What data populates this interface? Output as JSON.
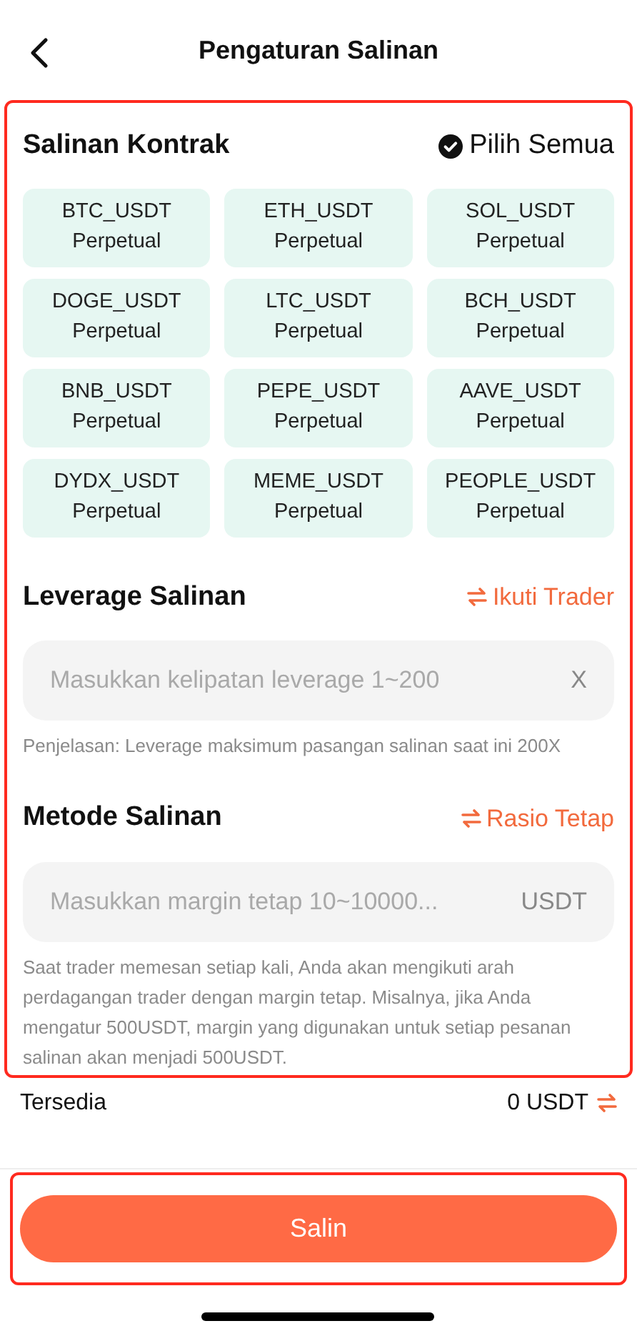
{
  "header": {
    "title": "Pengaturan Salinan"
  },
  "contracts": {
    "title": "Salinan Kontrak",
    "select_all": {
      "label": "Pilih Semua",
      "checked": true
    },
    "items": [
      {
        "symbol": "BTC_USDT",
        "type": "Perpetual",
        "selected": true
      },
      {
        "symbol": "ETH_USDT",
        "type": "Perpetual",
        "selected": true
      },
      {
        "symbol": "SOL_USDT",
        "type": "Perpetual",
        "selected": true
      },
      {
        "symbol": "DOGE_USDT",
        "type": "Perpetual",
        "selected": true
      },
      {
        "symbol": "LTC_USDT",
        "type": "Perpetual",
        "selected": true
      },
      {
        "symbol": "BCH_USDT",
        "type": "Perpetual",
        "selected": true
      },
      {
        "symbol": "BNB_USDT",
        "type": "Perpetual",
        "selected": true
      },
      {
        "symbol": "PEPE_USDT",
        "type": "Perpetual",
        "selected": true
      },
      {
        "symbol": "AAVE_USDT",
        "type": "Perpetual",
        "selected": true
      },
      {
        "symbol": "DYDX_USDT",
        "type": "Perpetual",
        "selected": true
      },
      {
        "symbol": "MEME_USDT",
        "type": "Perpetual",
        "selected": true
      },
      {
        "symbol": "PEOPLE_USDT",
        "type": "Perpetual",
        "selected": true
      }
    ]
  },
  "leverage": {
    "title": "Leverage Salinan",
    "switch_label": "Ikuti Trader",
    "placeholder": "Masukkan kelipatan leverage 1~200",
    "suffix": "X",
    "note": "Penjelasan: Leverage maksimum pasangan salinan saat ini 200X"
  },
  "method": {
    "title": "Metode Salinan",
    "switch_label": "Rasio Tetap",
    "placeholder": "Masukkan margin tetap 10~10000...",
    "suffix": "USDT",
    "note": "Saat trader memesan setiap kali, Anda akan mengikuti arah perdagangan trader dengan margin tetap. Misalnya, jika Anda mengatur 500USDT, margin yang digunakan untuk setiap pesanan salinan akan menjadi 500USDT."
  },
  "available": {
    "label": "Tersedia",
    "value": "0 USDT"
  },
  "submit": {
    "label": "Salin"
  }
}
